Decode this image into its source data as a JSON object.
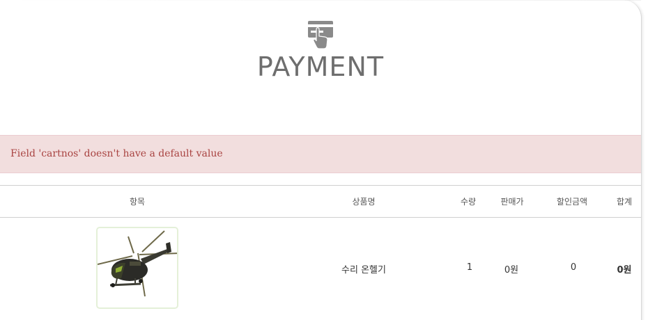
{
  "header": {
    "icon": "card-payment-icon",
    "title": "PAYMENT"
  },
  "alert": {
    "message": "Field 'cartnos' doesn't have a default value",
    "bg_color": "#f2dede",
    "text_color": "#a94442"
  },
  "table": {
    "columns": [
      "항목",
      "상품명",
      "수량",
      "판매가",
      "할인금액",
      "합계"
    ],
    "rows": [
      {
        "image": "helicopter-product-image",
        "name": "수리 온헬기",
        "qty": "1",
        "price": "0원",
        "discount": "0",
        "total": "0원"
      }
    ]
  }
}
